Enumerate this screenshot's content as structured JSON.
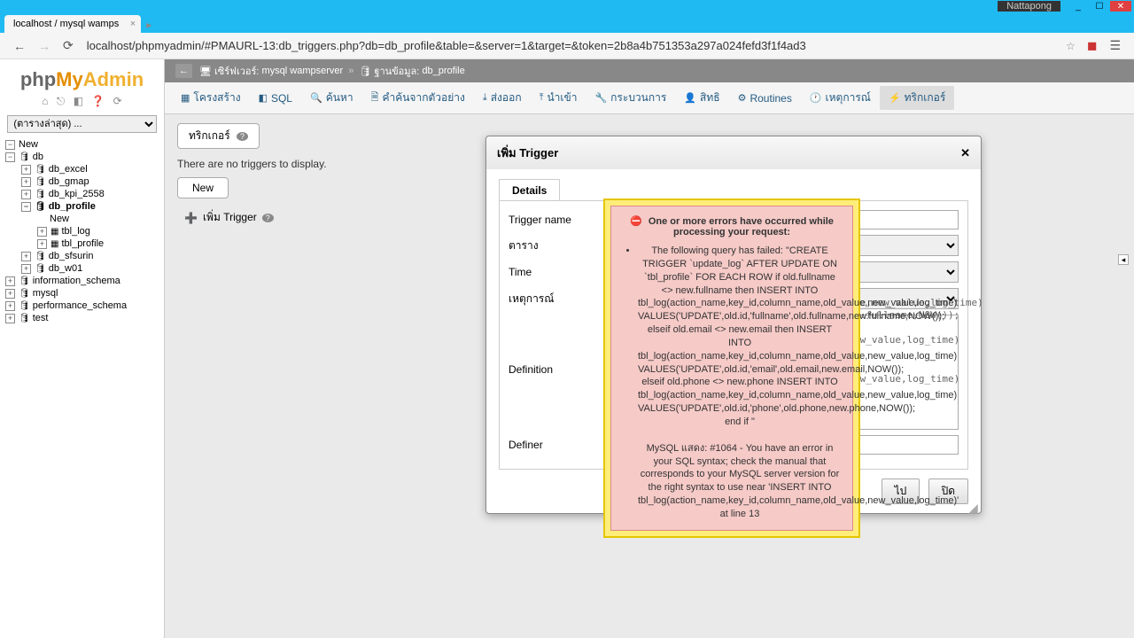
{
  "window": {
    "user": "Nattapong"
  },
  "tab": {
    "title": "localhost / mysql wamps"
  },
  "address": {
    "url": "localhost/phpmyadmin/#PMAURL-13:db_triggers.php?db=db_profile&table=&server=1&target=&token=2b8a4b751353a297a024fefd3f1f4ad3"
  },
  "sidebar": {
    "logo_php": "php",
    "logo_my": "My",
    "logo_admin": "Admin",
    "recent": "(ตารางล่าสุด) ...",
    "tree": {
      "new": "New",
      "db": "db",
      "db_excel": "db_excel",
      "db_gmap": "db_gmap",
      "db_kpi_2558": "db_kpi_2558",
      "db_profile": "db_profile",
      "db_profile_new": "New",
      "tbl_log": "tbl_log",
      "tbl_profile": "tbl_profile",
      "db_sfsurin": "db_sfsurin",
      "db_w01": "db_w01",
      "information_schema": "information_schema",
      "mysql": "mysql",
      "performance_schema": "performance_schema",
      "test": "test"
    }
  },
  "breadcrumb": {
    "server_label": "เซิร์ฟเวอร์:",
    "server": "mysql wampserver",
    "db_label": "ฐานข้อมูล:",
    "db": "db_profile"
  },
  "topmenu": {
    "structure": "โครงสร้าง",
    "sql": "SQL",
    "search": "ค้นหา",
    "query": "คำค้นจากตัวอย่าง",
    "export": "ส่งออก",
    "import": "นำเข้า",
    "operations": "กระบวนการ",
    "privileges": "สิทธิ",
    "routines": "Routines",
    "events": "เหตุการณ์",
    "triggers": "ทริกเกอร์"
  },
  "subtab": {
    "triggers": "ทริกเกอร์"
  },
  "body": {
    "no_triggers": "There are no triggers to display.",
    "new": "New",
    "add_trigger": "เพิ่ม Trigger"
  },
  "dialog": {
    "title": "เพิ่ม Trigger",
    "details": "Details",
    "labels": {
      "trigger_name": "Trigger name",
      "table": "ตาราง",
      "time": "Time",
      "event": "เหตุการณ์",
      "definition": "Definition",
      "definer": "Definer"
    },
    "bg_lines": {
      "l1": "me,new_value,log_time)",
      "l2": "w.fullname,NOW());",
      "l3": "ew_value,log_time)",
      "l4": "ew_value,log_time)"
    },
    "buttons": {
      "go": "ไป",
      "close": "ปิด"
    }
  },
  "error": {
    "title": "One or more errors have occurred while processing your request:",
    "body": "The following query has failed: \"CREATE TRIGGER `update_log` AFTER UPDATE ON `tbl_profile` FOR EACH ROW if old.fullname <> new.fullname then INSERT INTO tbl_log(action_name,key_id,column_name,old_value,new_value,log_time) VALUES('UPDATE',old.id,'fullname',old.fullname,new.fullname,NOW()); elseif old.email <> new.email then INSERT INTO tbl_log(action_name,key_id,column_name,old_value,new_value,log_time) VALUES('UPDATE',old.id,'email',old.email,new.email,NOW()); elseif old.phone <> new.phone INSERT INTO tbl_log(action_name,key_id,column_name,old_value,new_value,log_time) VALUES('UPDATE',old.id,'phone',old.phone,new.phone,NOW()); end if \"\n\nMySQL แสดง: #1064 - You have an error in your SQL syntax; check the manual that corresponds to your MySQL server version for the right syntax to use near 'INSERT INTO tbl_log(action_name,key_id,column_name,old_value,new_value,log_time)' at line 13"
  }
}
